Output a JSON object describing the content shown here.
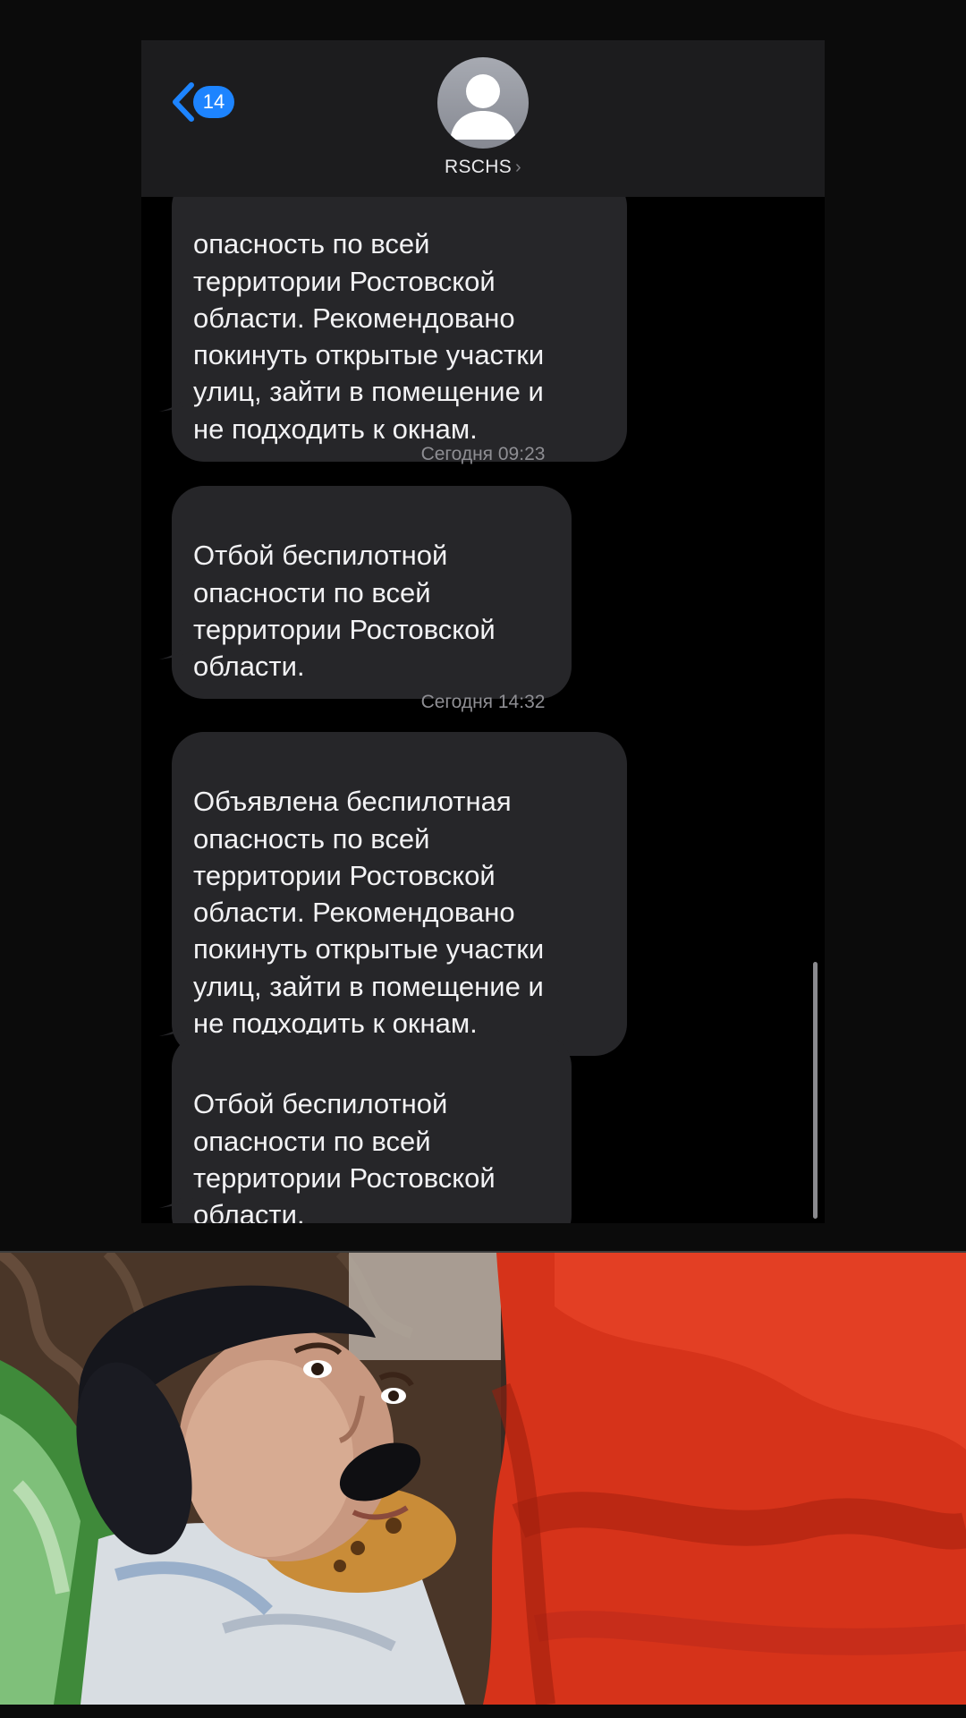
{
  "header": {
    "back_count": "14",
    "contact_name": "RSCHS",
    "contact_chevron": "›"
  },
  "messages": [
    {
      "type": "bubble",
      "text": "опасность по всей\nтерритории Ростовской\nобласти. Рекомендовано\nпокинуть открытые участки\nулиц, зайти в помещение и\nне подходить к окнам."
    },
    {
      "type": "timestamp",
      "text": "Сегодня 09:23"
    },
    {
      "type": "bubble",
      "text": "Отбой беспилотной\nопасности по всей\nтерритории Ростовской\nобласти."
    },
    {
      "type": "timestamp",
      "text": "Сегодня 14:32"
    },
    {
      "type": "bubble",
      "text": "Объявлена беспилотная\nопасность по всей\nтерритории Ростовской\nобласти. Рекомендовано\nпокинуть открытые участки\nулиц, зайти в помещение и\nне подходить к окнам."
    },
    {
      "type": "bubble",
      "text": "Отбой беспилотной\nопасности по всей\nтерритории Ростовской\nобласти."
    }
  ],
  "icons": {
    "back": "chevron-left-icon",
    "avatar": "person-silhouette-icon"
  },
  "colors": {
    "accent": "#1d84ff",
    "bubble": "#262629",
    "header": "#1c1c1e",
    "timestamp": "#8e8e93"
  }
}
